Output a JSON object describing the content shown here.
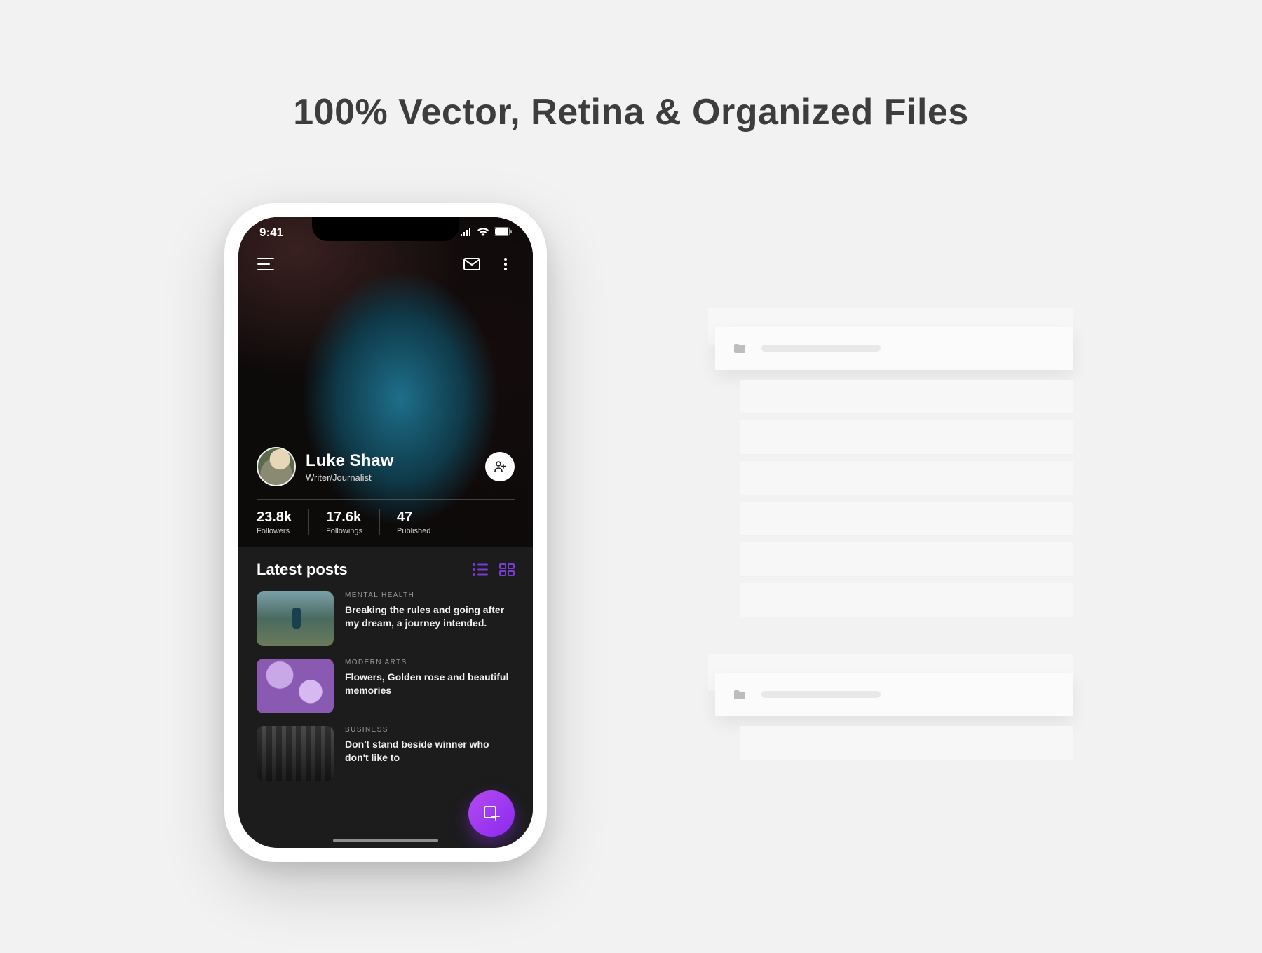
{
  "headline": "100% Vector, Retina & Organized Files",
  "statusbar": {
    "time": "9:41"
  },
  "profile": {
    "name": "Luke Shaw",
    "role": "Writer/Journalist"
  },
  "stats": [
    {
      "value": "23.8k",
      "label": "Followers"
    },
    {
      "value": "17.6k",
      "label": "Followings"
    },
    {
      "value": "47",
      "label": "Published"
    }
  ],
  "posts_section": {
    "heading": "Latest posts"
  },
  "posts": [
    {
      "category": "MENTAL HEALTH",
      "title": "Breaking the rules and going after my dream, a journey intended."
    },
    {
      "category": "MODERN ARTS",
      "title": "Flowers, Golden rose and beautiful memories"
    },
    {
      "category": "BUSINESS",
      "title": "Don't stand beside winner who don't like to"
    }
  ],
  "accent": "#8a2af0"
}
